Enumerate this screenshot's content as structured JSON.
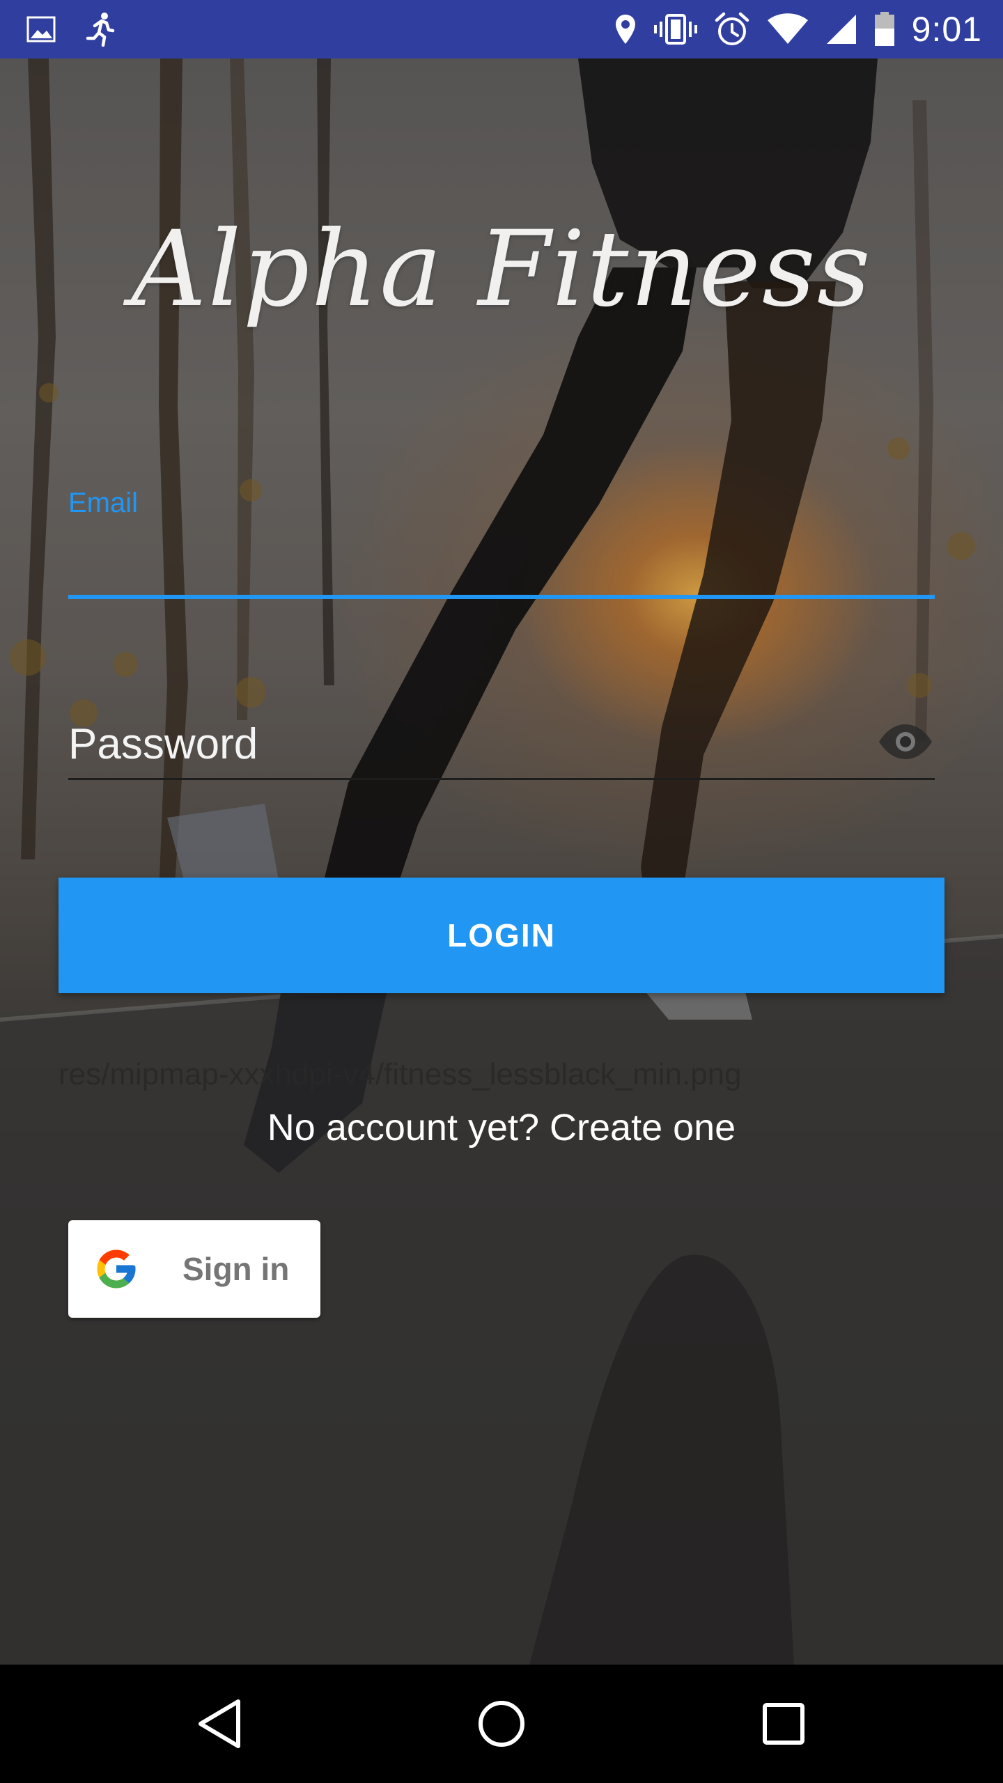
{
  "status_bar": {
    "time": "9:01",
    "icons": [
      "image-icon",
      "running-icon",
      "location-icon",
      "vibrate-icon",
      "alarm-icon",
      "wifi-icon",
      "signal-icon",
      "battery-icon"
    ]
  },
  "app": {
    "title": "Alpha Fitness"
  },
  "form": {
    "email_label": "Email",
    "email_value": "",
    "password_placeholder": "Password",
    "password_value": "",
    "login_label": "LOGIN",
    "debug_text": "res/mipmap-xxxhdpi-v4/fitness_lessblack_min.png",
    "create_account": "No account yet? Create one"
  },
  "google": {
    "label": "Sign in"
  },
  "colors": {
    "status_bar": "#303f9f",
    "accent": "#2196f3",
    "nav_bar": "#000000"
  }
}
